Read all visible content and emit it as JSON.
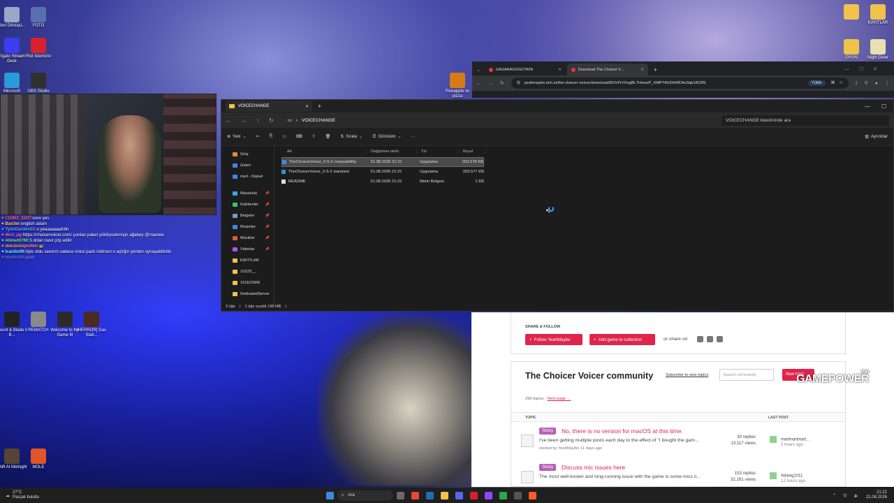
{
  "desktop": {
    "left_icons": [
      {
        "label": "Geri Dönüşü...",
        "color": "#9aa7c8"
      },
      {
        "label": "FOTO",
        "color": "#5a6fb0"
      },
      {
        "label": "Elgato Stream Deck",
        "color": "#3d3df0"
      },
      {
        "label": "Riot İstemcisi",
        "color": "#d8202e"
      },
      {
        "label": "Microsoft",
        "color": "#2a9ad8"
      },
      {
        "label": "OBS Studio",
        "color": "#303030"
      },
      {
        "label": "Pineapple on pizza",
        "color": "#d67b18"
      }
    ],
    "mid_icons": [
      {
        "label": "Mount & Blade II B...",
        "color": "#222"
      },
      {
        "label": "REMATCH",
        "color": "#8a8a8a"
      },
      {
        "label": "Welcome to the Game III",
        "color": "#2a2a2a"
      },
      {
        "label": "[HERROR] Gas Stati...",
        "color": "#4b2a20"
      }
    ],
    "bottom_icons": [
      {
        "label": "Shift At Midnight",
        "color": "#543"
      },
      {
        "label": "MOLE",
        "color": "#e0542a"
      }
    ],
    "right_icons": [
      {
        "label": "",
        "color": "#f0c24b"
      },
      {
        "label": "KAYITLAR",
        "color": "#f0c24b"
      },
      {
        "label": "OYUN",
        "color": "#f0c24b"
      },
      {
        "label": "Night Diner",
        "color": "#e8e0b0"
      }
    ]
  },
  "chat": [
    {
      "user": "CIZBIZ_EDIT:",
      "msg": "ovvv yes",
      "color": "#ff7070"
    },
    {
      "user": "Bav3er:",
      "msg": "english adam",
      "color": "#ffd24a"
    },
    {
      "user": "TylerDurden02:",
      "msg": "o yeaaaaaaahhh",
      "color": "#6aa8ff"
    },
    {
      "user": "dksl_pg:",
      "msg": "https://choicervoicer.com/ şurdan paket yüklüycekmişin ağabey @rraenee",
      "color": "#ff6ad8"
    },
    {
      "user": "Ahmet0760:",
      "msg": "5 dolar nasıl çöp edilir",
      "color": "#7af07a"
    },
    {
      "user": "deksketoprofen:",
      "msg": "🐢",
      "color": "#ff9a6a"
    },
    {
      "user": "lcardio99:",
      "msg": "öyle oldu sanırım sadece voice pack indirsen o açtığın yerden oynayabilirdin",
      "color": "#6affff"
    },
    {
      "user": "mmiks94:",
      "msg": "yeah",
      "color": "#bbbbbb"
    }
  ],
  "explorer": {
    "tab_title": "VOICECHANGE",
    "path": "VOICECHANGE",
    "search_placeholder": "VOICECHANGE klasöründe ara",
    "toolbar": {
      "new": "Yeni",
      "sort": "Sırala",
      "view": "Görünüm",
      "more": "···",
      "details": "Ayrıntılar"
    },
    "nav": [
      {
        "label": "Giriş",
        "color": "#e38a3a",
        "pinned": false
      },
      {
        "label": "Galeri",
        "color": "#3a8ae3",
        "pinned": false
      },
      {
        "label": "mert - Kişisel",
        "color": "#3a8ae3",
        "pinned": false
      },
      {
        "label": "Masaüstü",
        "color": "#3aa8e3",
        "pinned": true
      },
      {
        "label": "İndirilenler",
        "color": "#3ac36a",
        "pinned": true
      },
      {
        "label": "Belgeler",
        "color": "#7a9ac8",
        "pinned": true
      },
      {
        "label": "Resimler",
        "color": "#3a8ae3",
        "pinned": true
      },
      {
        "label": "Müzikler",
        "color": "#e35a3a",
        "pinned": true
      },
      {
        "label": "Videolar",
        "color": "#a35ae3",
        "pinned": true
      },
      {
        "label": "KAYITLAR",
        "color": "#f0c24b",
        "pinned": false
      },
      {
        "label": "10ZZ9__",
        "color": "#f0c24b",
        "pinned": false
      },
      {
        "label": "101EOSR6",
        "color": "#f0c24b",
        "pinned": false
      },
      {
        "label": "DedicatedServer",
        "color": "#f0c24b",
        "pinned": false
      }
    ],
    "columns": [
      "Ad",
      "Değiştirme tarihi",
      "Tür",
      "Boyut"
    ],
    "files": [
      {
        "name": "TheChoicerVoicer_0-5-2 compatibility",
        "date": "21.08.2026 21:21",
        "type": "Uygulama",
        "size": "203.578 KB",
        "selected": true
      },
      {
        "name": "TheChoicerVoicer_0-5-2 standard",
        "date": "21.08.2026 21:21",
        "type": "Uygulama",
        "size": "203.577 KB",
        "selected": false
      },
      {
        "name": "README",
        "date": "21.08.2026 21:21",
        "type": "Metin Belgesi",
        "size": "1 KB",
        "selected": false
      }
    ],
    "status": {
      "count": "3 öğe",
      "selected": "1 öğe seçildi  198 MB"
    }
  },
  "browser": {
    "tabs": [
      {
        "title": "GAGARAGOGOTATA",
        "active": false
      },
      {
        "title": "Download The Choicer V...",
        "active": true
      }
    ],
    "url": "yeahmaybe.itch.io/the-choicer-voicer/download/BSVFiVXogBL7HnwsP_XMPTAIrDhRfDAv3qb18CRE",
    "install_label": "Yükle"
  },
  "web": {
    "share_label": "SHARE & FOLLOW",
    "follow_btn": "Follow YeahMaybe",
    "collection_btn": "Add game to collection",
    "or_share": "or share on",
    "community_title": "The Choicer Voicer community",
    "subscribe": "Subscribe to new topics",
    "search_placeholder": "Search community",
    "new_topic": "New topic",
    "topics_count": "290 topics",
    "next_page": "Next page →",
    "col_topic": "TOPIC",
    "col_last": "LAST POST",
    "topics": [
      {
        "badge": "Sticky",
        "title": "No, there is no version for macOS at this time.",
        "excerpt": "I've been getting multiple posts each day to the effect of \"I bought the gam...",
        "by": "started by YeahMaybe 11 days ago",
        "replies": "30 replies",
        "views": "13,117 views",
        "last_user": "martmartmart...",
        "last_time": "3 hours ago"
      },
      {
        "badge": "Sticky",
        "title": "Discuss mic issues here",
        "excerpt": "The most well-known and long-running issue with the game is some mics n...",
        "by": "",
        "replies": "153 replies",
        "views": "32,291 views",
        "last_user": "Adawg1011",
        "last_time": "12 hours ago"
      }
    ]
  },
  "watermark": {
    "number": "290",
    "brand": "GAMEPOWER"
  },
  "taskbar": {
    "weather_temp": "27°C",
    "weather_text": "Parçalı bulutlu",
    "search": "Ara",
    "time": "21:22",
    "date": "21.08.2026"
  }
}
